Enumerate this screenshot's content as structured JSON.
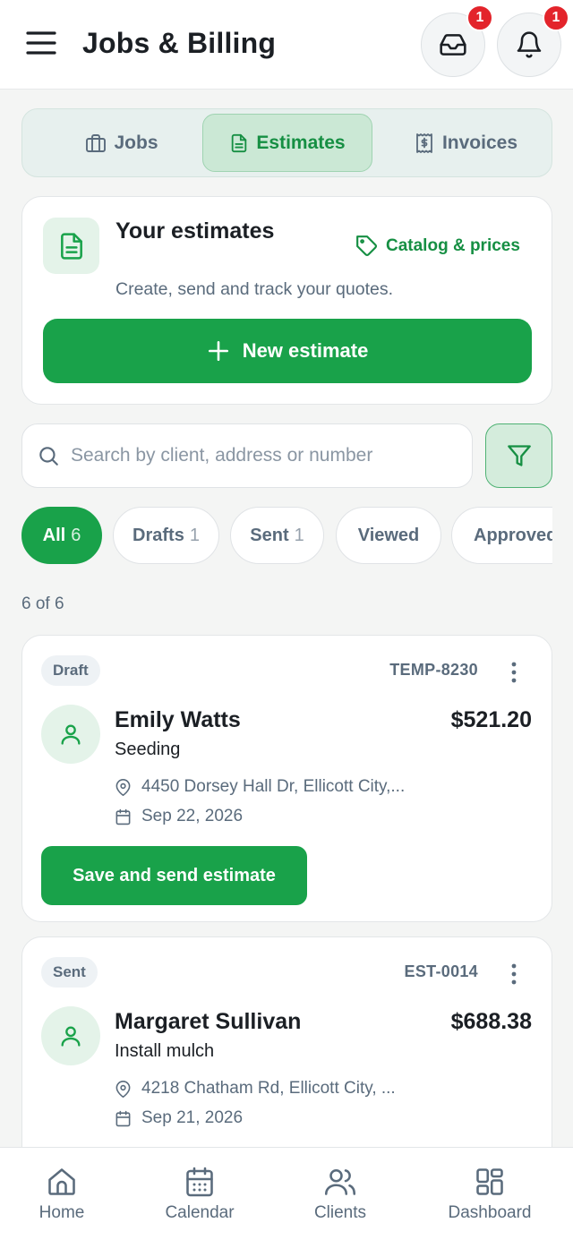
{
  "header": {
    "title": "Jobs & Billing",
    "inbox_badge": "1",
    "notifications_badge": "1"
  },
  "tabs": [
    {
      "label": "Jobs",
      "icon": "briefcase-icon"
    },
    {
      "label": "Estimates",
      "icon": "document-icon",
      "active": true
    },
    {
      "label": "Invoices",
      "icon": "receipt-icon"
    }
  ],
  "estimates_card": {
    "title": "Your estimates",
    "subtitle": "Create, send and track your quotes.",
    "catalog_link": "Catalog & prices",
    "new_button": "New estimate"
  },
  "search": {
    "placeholder": "Search by client, address or number",
    "value": ""
  },
  "filters": [
    {
      "label": "All",
      "count": "6",
      "active": true
    },
    {
      "label": "Drafts",
      "count": "1"
    },
    {
      "label": "Sent",
      "count": "1"
    },
    {
      "label": "Viewed",
      "count": ""
    },
    {
      "label": "Approved",
      "count": ""
    }
  ],
  "result_count": "6 of 6",
  "estimates": [
    {
      "status": "Draft",
      "number": "TEMP-8230",
      "client": "Emily Watts",
      "amount": "$521.20",
      "service": "Seeding",
      "address": "4450 Dorsey Hall Dr, Ellicott City,...",
      "date": "Sep 22, 2026",
      "action": "Save and send estimate"
    },
    {
      "status": "Sent",
      "number": "EST-0014",
      "client": "Margaret Sullivan",
      "amount": "$688.38",
      "service": "Install mulch",
      "address": "4218 Chatham Rd, Ellicott City, ...",
      "date": "Sep 21, 2026"
    }
  ],
  "bottom_nav": [
    {
      "label": "Home",
      "icon": "home-icon"
    },
    {
      "label": "Calendar",
      "icon": "calendar-icon"
    },
    {
      "label": "Clients",
      "icon": "users-icon"
    },
    {
      "label": "Dashboard",
      "icon": "dashboard-icon"
    }
  ],
  "colors": {
    "primary": "#19a24a",
    "primary_text": "#168f43",
    "badge": "#e3242b",
    "muted_text": "#5a6b7c"
  }
}
